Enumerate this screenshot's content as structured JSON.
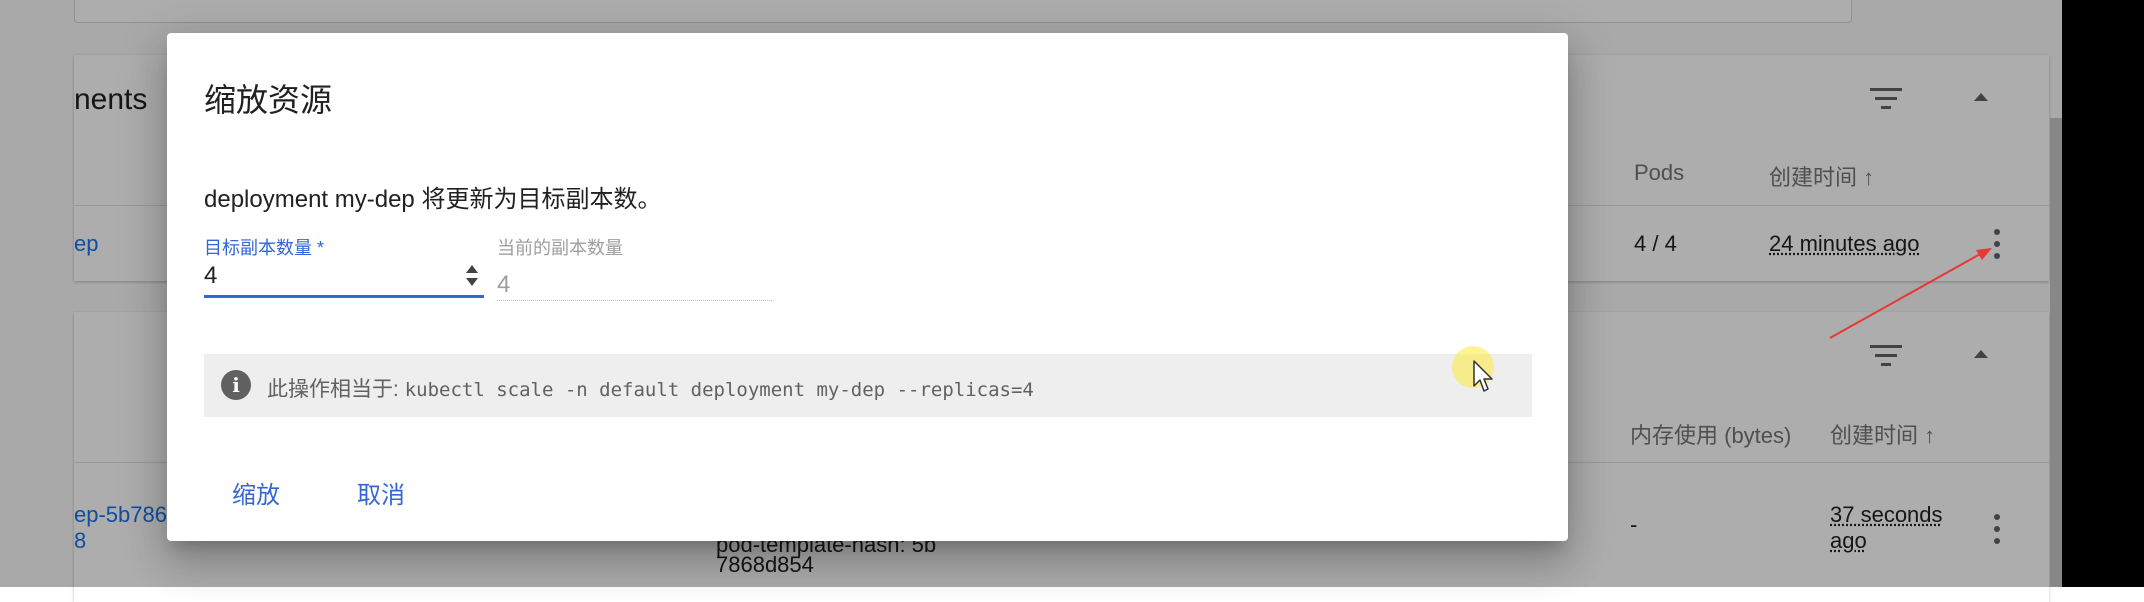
{
  "background": {
    "card1": {
      "title": "nents",
      "headers": {
        "pods": "Pods",
        "created": "创建时间"
      },
      "row": {
        "name": "ep",
        "pods": "4 / 4",
        "created": "24 minutes ago"
      }
    },
    "card2": {
      "headers": {
        "memory": "内存使用 (bytes)",
        "created": "创建时间"
      },
      "row": {
        "name_line1": "ep-5b786",
        "name_line2": "8",
        "labels_line1": "pod-template-hash: 5b",
        "labels_line2": "7868d854",
        "memory": "-",
        "created_line1": "37 seconds",
        "created_line2": "ago"
      }
    }
  },
  "dialog": {
    "title": "缩放资源",
    "description": "deployment my-dep 将更新为目标副本数。",
    "target_label": "目标副本数量 *",
    "target_value": "4",
    "current_label": "当前的副本数量",
    "current_value": "4",
    "info_prefix": "此操作相当于:",
    "info_command": "kubectl scale -n default deployment my-dep --replicas=4",
    "scale_button": "缩放",
    "cancel_button": "取消"
  },
  "icons": [
    "filter-icon",
    "collapse-icon",
    "sort-arrow-up-icon",
    "more-vert-icon",
    "info-icon",
    "number-spinner-icon",
    "mouse-cursor-icon"
  ],
  "colors": {
    "accent": "#3367d6",
    "link": "#1a73e8",
    "annotation_arrow": "#e53935",
    "cursor_highlight": "#ffeb3b"
  }
}
